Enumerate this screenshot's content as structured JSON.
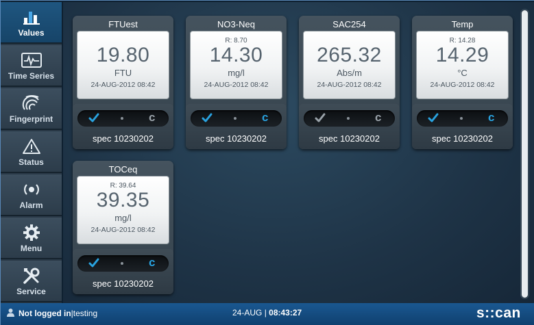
{
  "nav": {
    "items": [
      {
        "label": "Values",
        "icon": "bar-chart-icon",
        "active": true
      },
      {
        "label": "Time Series",
        "icon": "waveform-icon",
        "active": false
      },
      {
        "label": "Fingerprint",
        "icon": "fingerprint-icon",
        "active": false
      },
      {
        "label": "Status",
        "icon": "warning-icon",
        "active": false
      },
      {
        "label": "Alarm",
        "icon": "alarm-icon",
        "active": false
      },
      {
        "label": "Menu",
        "icon": "gear-icon",
        "active": false
      },
      {
        "label": "Service",
        "icon": "tools-icon",
        "active": false
      }
    ]
  },
  "cards": [
    {
      "title": "FTUest",
      "raw": "",
      "value": "19.80",
      "unit": "FTU",
      "timestamp": "24-AUG-2012 08:42",
      "check_color": "#29a3e0",
      "c_color": "#9aa3aa",
      "spec": "spec 10230202"
    },
    {
      "title": "NO3-Neq",
      "raw": "R: 8.70",
      "value": "14.30",
      "unit": "mg/l",
      "timestamp": "24-AUG-2012 08:42",
      "check_color": "#29a3e0",
      "c_color": "#29a3e0",
      "spec": "spec 10230202"
    },
    {
      "title": "SAC254",
      "raw": "",
      "value": "265.32",
      "unit": "Abs/m",
      "timestamp": "24-AUG-2012 08:42",
      "check_color": "#9aa3aa",
      "c_color": "#9aa3aa",
      "spec": "spec 10230202"
    },
    {
      "title": "Temp",
      "raw": "R: 14.28",
      "value": "14.29",
      "unit": "°C",
      "timestamp": "24-AUG-2012 08:42",
      "check_color": "#29a3e0",
      "c_color": "#29a3e0",
      "spec": "spec 10230202"
    },
    {
      "title": "TOCeq",
      "raw": "R: 39.64",
      "value": "39.35",
      "unit": "mg/l",
      "timestamp": "24-AUG-2012 08:42",
      "check_color": "#29a3e0",
      "c_color": "#29a3e0",
      "spec": "spec 10230202"
    }
  ],
  "footer": {
    "login_status": "Not logged in",
    "separator": " | ",
    "login_user": "testing",
    "date": "24-AUG",
    "date_sep": " | ",
    "time": "08:43:27",
    "logo": "s::can"
  },
  "colors": {
    "accent": "#29a3e0",
    "active_nav": "#1f5680",
    "footer": "#1a5891"
  }
}
